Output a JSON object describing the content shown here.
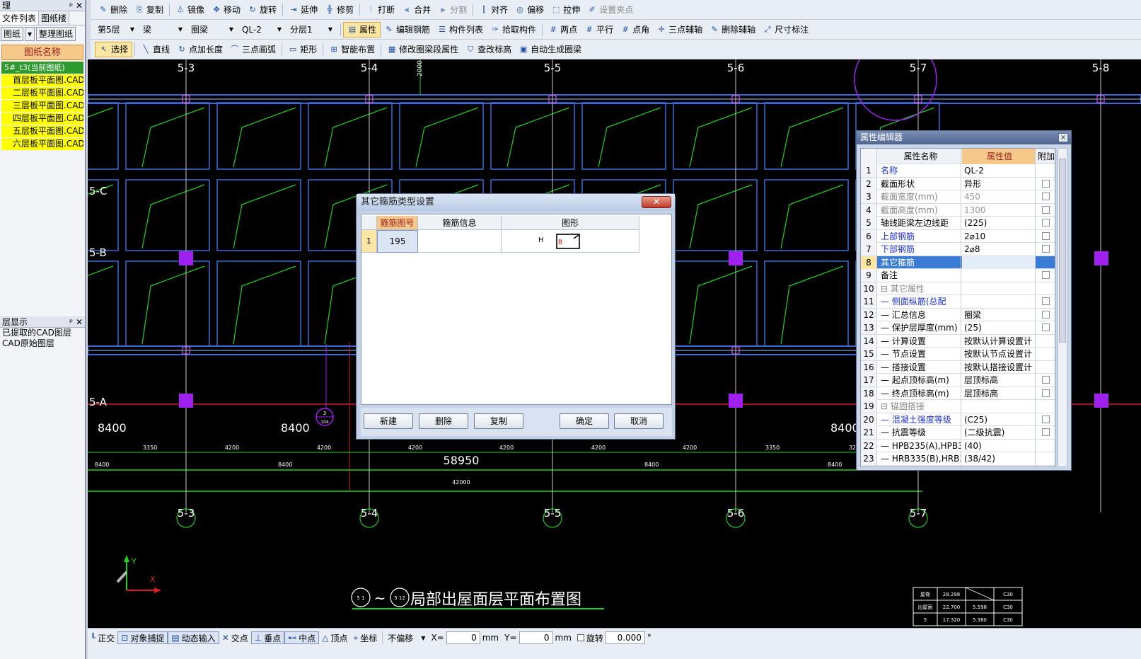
{
  "toolbar1": {
    "items": [
      {
        "label": "删除",
        "icon": "delete-icon",
        "symbol": "✎"
      },
      {
        "label": "复制",
        "icon": "copy-icon",
        "symbol": "⎘"
      },
      {
        "label": "镜像",
        "icon": "mirror-icon",
        "symbol": "⏃"
      },
      {
        "label": "移动",
        "icon": "move-icon",
        "symbol": "✥"
      },
      {
        "label": "旋转",
        "icon": "rotate-icon",
        "symbol": "↻"
      },
      {
        "label": "延伸",
        "icon": "extend-icon",
        "symbol": "⇥"
      },
      {
        "label": "修剪",
        "icon": "trim-icon",
        "symbol": "╬"
      },
      {
        "label": "打断",
        "icon": "break-icon",
        "symbol": "⫶"
      },
      {
        "label": "合并",
        "icon": "merge-icon",
        "symbol": "⫷"
      },
      {
        "label": "分割",
        "icon": "split-icon",
        "symbol": "⫸"
      },
      {
        "label": "对齐",
        "icon": "align-icon",
        "symbol": "⫿"
      },
      {
        "label": "偏移",
        "icon": "offset-icon",
        "symbol": "◎"
      },
      {
        "label": "拉伸",
        "icon": "stretch-icon",
        "symbol": "⬚"
      },
      {
        "label": "设置夹点",
        "icon": "grip-icon",
        "symbol": "✐"
      }
    ]
  },
  "toolbar2": {
    "floor": "第5层",
    "element_type": "梁",
    "element_subtype": "圈梁",
    "element_name": "QL-2",
    "layer": "分层1",
    "items": [
      {
        "label": "属性",
        "icon": "properties-icon",
        "symbol": "▤"
      },
      {
        "label": "编辑钢筋",
        "icon": "edit-rebar-icon",
        "symbol": "✎"
      },
      {
        "label": "构件列表",
        "icon": "component-list-icon",
        "symbol": "☰"
      },
      {
        "label": "拾取构件",
        "icon": "pick-component-icon",
        "symbol": "✑"
      },
      {
        "label": "两点",
        "icon": "two-points-icon",
        "symbol": "#"
      },
      {
        "label": "平行",
        "icon": "parallel-icon",
        "symbol": "#"
      },
      {
        "label": "点角",
        "icon": "point-angle-icon",
        "symbol": "#"
      },
      {
        "label": "三点辅轴",
        "icon": "three-point-axis-icon",
        "symbol": "✛"
      },
      {
        "label": "删除辅轴",
        "icon": "delete-axis-icon",
        "symbol": "✎"
      },
      {
        "label": "尺寸标注",
        "icon": "dimension-icon",
        "symbol": "⤢"
      }
    ]
  },
  "toolbar3": {
    "items": [
      {
        "label": "选择",
        "icon": "select-icon",
        "symbol": "↖"
      },
      {
        "label": "直线",
        "icon": "line-icon",
        "symbol": "╲"
      },
      {
        "label": "点加长度",
        "icon": "point-length-icon",
        "symbol": "↻"
      },
      {
        "label": "三点画弧",
        "icon": "arc-icon",
        "symbol": "⌒"
      },
      {
        "label": "矩形",
        "icon": "rectangle-icon",
        "symbol": "▭"
      },
      {
        "label": "智能布置",
        "icon": "smart-layout-icon",
        "symbol": "⊞"
      },
      {
        "label": "修改圈梁段属性",
        "icon": "modify-segment-icon",
        "symbol": "▦"
      },
      {
        "label": "查改标高",
        "icon": "check-elevation-icon",
        "symbol": "⛉"
      },
      {
        "label": "自动生成圈梁",
        "icon": "auto-generate-icon",
        "symbol": "▣"
      }
    ]
  },
  "left_panel": {
    "title": "理",
    "tabs": [
      "文件列表",
      "图纸楼"
    ],
    "buttons": [
      "图纸",
      "整理图纸"
    ],
    "list_header": "图纸名称",
    "current": "5#_t3(当前图纸)",
    "drawings": [
      "首层板平面图.CADI",
      "二层板平面图.CADI",
      "三层板平面图.CADI",
      "四层板平面图.CADI",
      "五层板平面图.CADI",
      "六层板平面图.CADI"
    ],
    "layer_title": "层显示",
    "layer_items": [
      "已提取的CAD图层",
      "CAD原始图层"
    ]
  },
  "drawing": {
    "axis_top": [
      "5-3",
      "5-4",
      "5-5",
      "5-6",
      "5-7",
      "5-8"
    ],
    "axis_left": [
      "5-C",
      "5-B",
      "5-A"
    ],
    "big_dims": [
      "8400",
      "8400",
      "8400"
    ],
    "total_dim": "58950",
    "small_dims": [
      "3350",
      "4200",
      "4200",
      "4200",
      "4200",
      "4200",
      "4200",
      "3350",
      "3250"
    ],
    "row_dims": [
      "8400",
      "8400",
      "8400",
      "8400"
    ],
    "overall": "42000",
    "vert_dim": "2000",
    "plan_title": "局部出屋面层平面布置图",
    "plan_title_sep": "~",
    "sym_a": "5 1",
    "sym_b": "5 12",
    "symbol_top": "3",
    "symbol_bottom": "104",
    "ucs_x": "X",
    "ucs_y": "Y",
    "level_table": [
      [
        "屋脊",
        "28.298",
        "",
        "C30"
      ],
      [
        "出屋面",
        "22.700",
        "5.598",
        "C30"
      ],
      [
        "5",
        "17.320",
        "5.380",
        "C30"
      ]
    ]
  },
  "dialog": {
    "title": "其它箍筋类型设置",
    "close": "✕",
    "columns": [
      "箍筋图号",
      "箍筋信息",
      "图形"
    ],
    "row_index": "1",
    "stirrup_no": "195",
    "stirrup_info": "",
    "shape_h": "H",
    "shape_b": "B",
    "buttons": {
      "new": "新建",
      "delete": "删除",
      "copy": "复制",
      "ok": "确定",
      "cancel": "取消"
    }
  },
  "prop_editor": {
    "title": "属性编辑器",
    "close": "×",
    "columns": [
      "属性名称",
      "属性值",
      "附加"
    ],
    "rows": [
      {
        "n": "1",
        "k": "名称",
        "v": "QL-2",
        "style": "blue",
        "chk": false
      },
      {
        "n": "2",
        "k": "截面形状",
        "v": "异形",
        "style": "",
        "chk": true
      },
      {
        "n": "3",
        "k": "截面宽度(mm)",
        "v": "450",
        "style": "gray",
        "chk": true
      },
      {
        "n": "4",
        "k": "截面高度(mm)",
        "v": "1300",
        "style": "gray",
        "chk": true
      },
      {
        "n": "5",
        "k": "轴线距梁左边线距",
        "v": "(225)",
        "style": "",
        "chk": true
      },
      {
        "n": "6",
        "k": "上部钢筋",
        "v": "2⌀10",
        "style": "blue",
        "chk": true
      },
      {
        "n": "7",
        "k": "下部钢筋",
        "v": "2⌀8",
        "style": "blue",
        "chk": true
      },
      {
        "n": "8",
        "k": "其它箍筋",
        "v": "",
        "style": "sel",
        "chk": false
      },
      {
        "n": "9",
        "k": "备注",
        "v": "",
        "style": "",
        "chk": true
      },
      {
        "n": "10",
        "k": "⊟ 其它属性",
        "v": "",
        "style": "group",
        "chk": false
      },
      {
        "n": "11",
        "k": "— 侧面纵筋(总配",
        "v": "",
        "style": "blue",
        "chk": true
      },
      {
        "n": "12",
        "k": "— 汇总信息",
        "v": "圈梁",
        "style": "",
        "chk": true
      },
      {
        "n": "13",
        "k": "— 保护层厚度(mm)",
        "v": "(25)",
        "style": "",
        "chk": true
      },
      {
        "n": "14",
        "k": "— 计算设置",
        "v": "按默认计算设置计",
        "style": "",
        "chk": false
      },
      {
        "n": "15",
        "k": "— 节点设置",
        "v": "按默认节点设置计",
        "style": "",
        "chk": false
      },
      {
        "n": "16",
        "k": "— 搭接设置",
        "v": "按默认搭接设置计",
        "style": "",
        "chk": false
      },
      {
        "n": "17",
        "k": "— 起点顶标高(m)",
        "v": "层顶标高",
        "style": "",
        "chk": true
      },
      {
        "n": "18",
        "k": "— 终点顶标高(m)",
        "v": "层顶标高",
        "style": "",
        "chk": true
      },
      {
        "n": "19",
        "k": "⊟ 锚固搭接",
        "v": "",
        "style": "group",
        "chk": false
      },
      {
        "n": "20",
        "k": "— 混凝土强度等级",
        "v": "(C25)",
        "style": "blue",
        "chk": true
      },
      {
        "n": "21",
        "k": "— 抗震等级",
        "v": "(二级抗震)",
        "style": "",
        "chk": true
      },
      {
        "n": "22",
        "k": "— HPB235(A),HPB3",
        "v": "(40)",
        "style": "",
        "chk": false
      },
      {
        "n": "23",
        "k": "— HRB335(B),HRB3",
        "v": "(38/42)",
        "style": "",
        "chk": false
      }
    ]
  },
  "statusbar": {
    "items": [
      {
        "label": "正交",
        "icon": "ortho-icon",
        "symbol": "┖",
        "on": false
      },
      {
        "label": "对象捕捉",
        "icon": "object-snap-icon",
        "symbol": "⊡",
        "on": true
      },
      {
        "label": "动态输入",
        "icon": "dynamic-input-icon",
        "symbol": "▤",
        "on": true
      },
      {
        "label": "交点",
        "icon": "intersection-icon",
        "symbol": "✕",
        "on": false
      },
      {
        "label": "垂点",
        "icon": "perpendicular-icon",
        "symbol": "⊥",
        "on": true
      },
      {
        "label": "中点",
        "icon": "midpoint-icon",
        "symbol": "⊷",
        "on": true
      },
      {
        "label": "顶点",
        "icon": "vertex-icon",
        "symbol": "△",
        "on": false
      },
      {
        "label": "坐标",
        "icon": "coordinate-icon",
        "symbol": "⌖",
        "on": false
      }
    ],
    "offset_mode": "不偏移",
    "x_label": "X=",
    "x_value": "0",
    "unit": "mm",
    "y_label": "Y=",
    "y_value": "0",
    "rotate_label": "旋转",
    "rotate_value": "0.000",
    "degree": "°"
  }
}
